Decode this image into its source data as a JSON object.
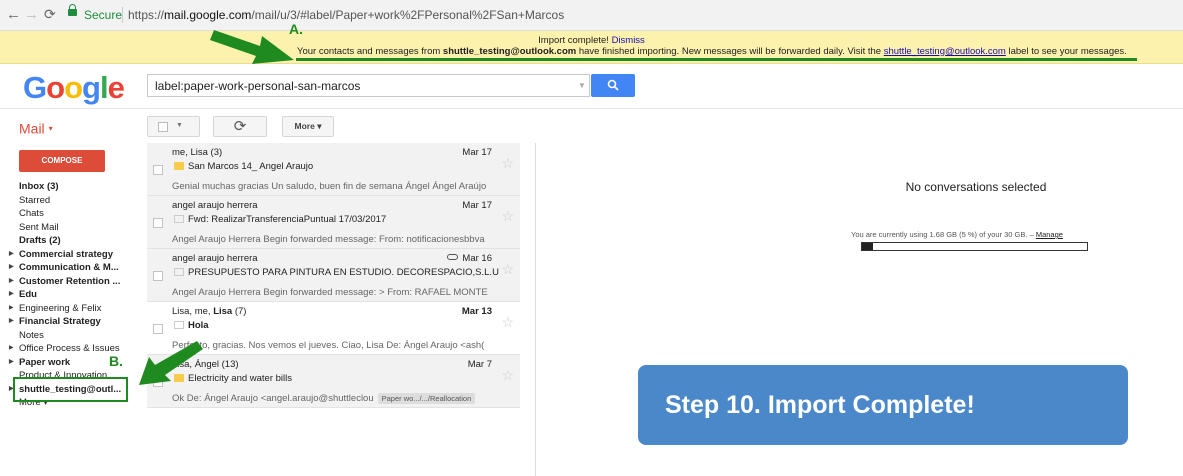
{
  "browser": {
    "secure_label": "Secure",
    "url_prefix": "https://",
    "url_host": "mail.google.com",
    "url_path": "/mail/u/3/#label/Paper+work%2FPersonal%2FSan+Marcos"
  },
  "banner": {
    "title": "Import complete!",
    "dismiss": "Dismiss",
    "msg_pre": "Your contacts and messages from ",
    "msg_account": "shuttle_testing@outlook.com",
    "msg_mid": " have finished importing. New messages will be forwarded daily. Visit the ",
    "msg_link": "shuttle_testing@outlook.com",
    "msg_post": " label to see your messages."
  },
  "header": {
    "logo": "Google",
    "search_value": "label:paper-work-personal-san-marcos"
  },
  "toolbar": {
    "mail_label": "Mail",
    "more_label": "More",
    "refresh_glyph": "⟳"
  },
  "compose_label": "COMPOSE",
  "sidebar": [
    {
      "label": "Inbox (3)",
      "bold": true,
      "expand": false
    },
    {
      "label": "Starred",
      "bold": false,
      "expand": false
    },
    {
      "label": "Chats",
      "bold": false,
      "expand": false
    },
    {
      "label": "Sent Mail",
      "bold": false,
      "expand": false
    },
    {
      "label": "Drafts (2)",
      "bold": true,
      "expand": false
    },
    {
      "label": "Commercial strategy",
      "bold": true,
      "expand": true
    },
    {
      "label": "Communication & M...",
      "bold": true,
      "expand": true
    },
    {
      "label": "Customer Retention ...",
      "bold": true,
      "expand": true
    },
    {
      "label": "Edu",
      "bold": true,
      "expand": true
    },
    {
      "label": "Engineering & Felix",
      "bold": false,
      "expand": true
    },
    {
      "label": "Financial Strategy",
      "bold": true,
      "expand": true
    },
    {
      "label": "Notes",
      "bold": false,
      "expand": false
    },
    {
      "label": "Office Process & Issues",
      "bold": false,
      "expand": true
    },
    {
      "label": "Paper work",
      "bold": true,
      "expand": true
    },
    {
      "label": "Product & Innovation",
      "bold": false,
      "expand": false
    },
    {
      "label": "shuttle_testing@outl...",
      "bold": true,
      "expand": true
    },
    {
      "label": "More ▾",
      "bold": false,
      "expand": false
    }
  ],
  "messages": [
    {
      "sender": "me, Lisa (3)",
      "date": "Mar 17",
      "subject": "San Marcos 14_ Angel Araujo",
      "snippet": "Genial muchas gracias Un saludo, buen fin de semana Ángel Ángel Araújo",
      "unread": false,
      "label": true,
      "attach": false,
      "tag": ""
    },
    {
      "sender": "angel araujo herrera",
      "date": "Mar 17",
      "subject": "Fwd: RealizarTransferenciaPuntual 17/03/2017",
      "snippet": "Angel Araujo Herrera Begin forwarded message: From: notificacionesbbva",
      "unread": false,
      "label": false,
      "attach": false,
      "tag": ""
    },
    {
      "sender": "angel araujo herrera",
      "date": "Mar 16",
      "subject": "PRESUPUESTO PARA PINTURA EN ESTUDIO. DECORESPACIO,S.L.U",
      "snippet": "Angel Araujo Herrera Begin forwarded message: > From: RAFAEL MONTE",
      "unread": false,
      "label": false,
      "attach": true,
      "tag": ""
    },
    {
      "sender": "Lisa, me, ",
      "sender_bold": "Lisa",
      "sender_suffix": " (7)",
      "date": "Mar 13",
      "subject": "Hola",
      "snippet": "Perfecto, gracias. Nos vemos el jueves. Ciao, Lisa De: Ángel Araujo <ash(",
      "unread": true,
      "label": false,
      "attach": false,
      "tag": ""
    },
    {
      "sender": "Lisa, Ángel (13)",
      "date": "Mar 7",
      "subject": "Electricity and water bills",
      "snippet": "Ok De: Ángel Araujo <angel.araujo@shuttleclou",
      "unread": false,
      "label": true,
      "attach": false,
      "tag": "Paper wo.../.../Reallocation"
    }
  ],
  "reading": {
    "no_conv": "No conversations selected",
    "storage_text": "You are currently using 1.68 GB (5 %) of your 30 GB. – ",
    "manage": "Manage",
    "usage_fraction": 0.05
  },
  "annotations": {
    "a": "A.",
    "b": "B.",
    "step": "Step 10. Import Complete!"
  },
  "colors": {
    "accent_green": "#1f8a1f",
    "step_blue": "#4a88c9",
    "gmail_red": "#dd4b39",
    "search_blue": "#4285f4",
    "banner_yellow": "#fcf2ad"
  }
}
